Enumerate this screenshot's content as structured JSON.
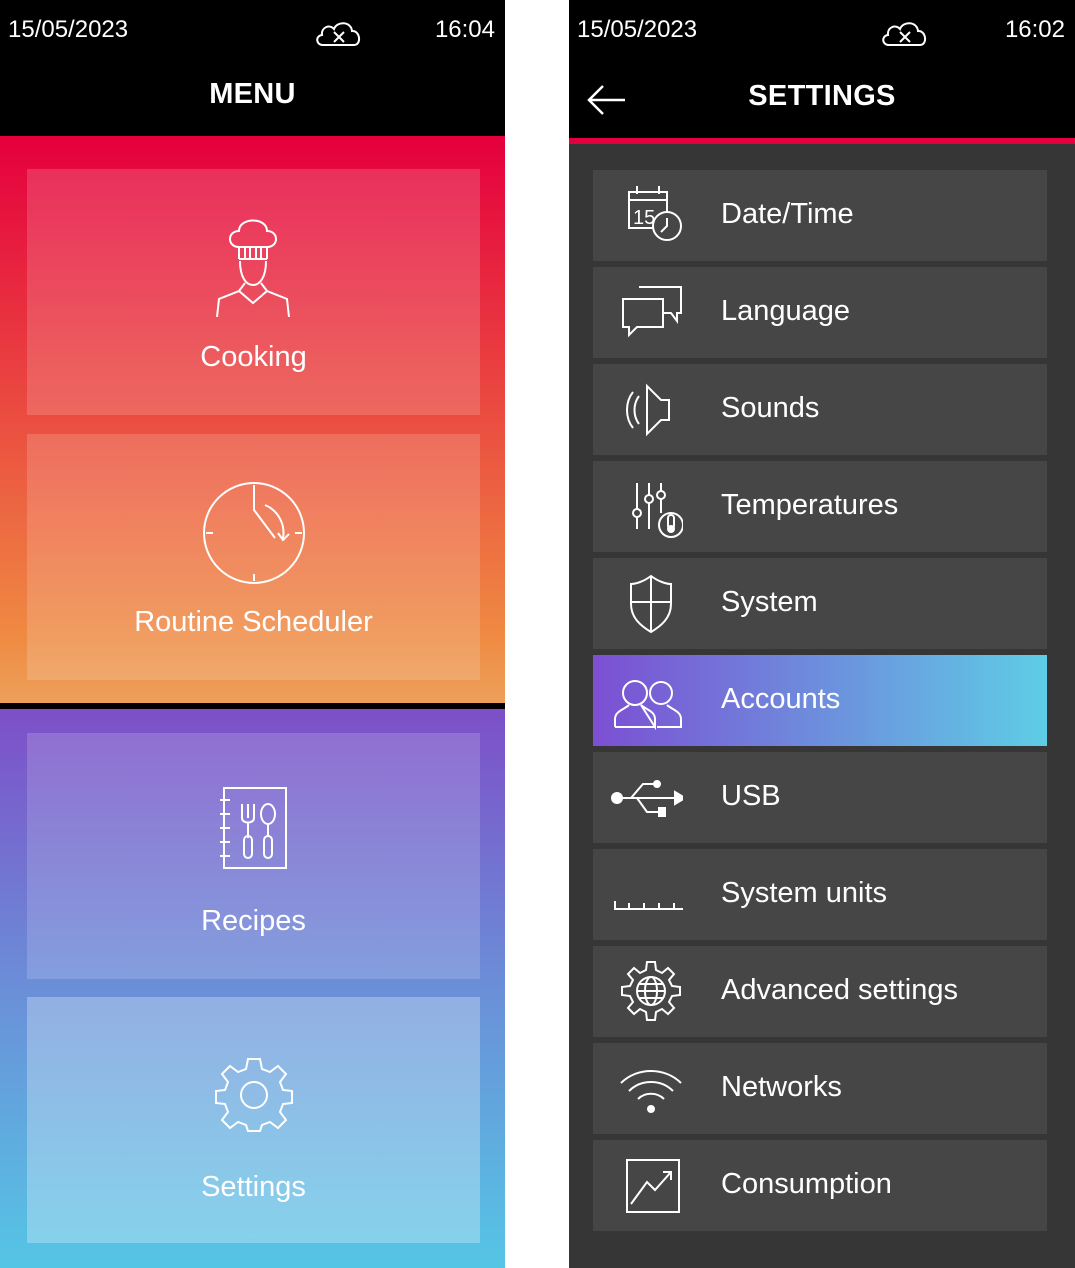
{
  "menu": {
    "status": {
      "date": "15/05/2023",
      "time": "16:04",
      "cloud_icon": "cloud-disconnected-icon"
    },
    "title": "MENU",
    "tiles": [
      {
        "label": "Cooking",
        "icon": "chef-icon"
      },
      {
        "label": "Routine Scheduler",
        "icon": "clock-icon"
      },
      {
        "label": "Recipes",
        "icon": "recipe-book-icon"
      },
      {
        "label": "Settings",
        "icon": "gear-icon"
      }
    ],
    "colors": {
      "accent_red": "#e5003d",
      "warm_top": "#e5003e",
      "warm_bottom": "#eda05a",
      "cool_top": "#7d4fc8",
      "cool_bottom": "#55c5e5"
    }
  },
  "settings": {
    "status": {
      "date": "15/05/2023",
      "time": "16:02",
      "cloud_icon": "cloud-disconnected-icon"
    },
    "title": "SETTINGS",
    "back_icon": "back-arrow-icon",
    "items": [
      {
        "label": "Date/Time",
        "icon": "calendar-clock-icon"
      },
      {
        "label": "Language",
        "icon": "chat-bubbles-icon"
      },
      {
        "label": "Sounds",
        "icon": "speaker-icon"
      },
      {
        "label": "Temperatures",
        "icon": "sliders-thermometer-icon"
      },
      {
        "label": "System",
        "icon": "shield-icon"
      },
      {
        "label": "Accounts",
        "icon": "users-icon",
        "selected": true
      },
      {
        "label": "USB",
        "icon": "usb-icon"
      },
      {
        "label": "System units",
        "icon": "ruler-icon"
      },
      {
        "label": "Advanced settings",
        "icon": "gear-globe-icon"
      },
      {
        "label": "Networks",
        "icon": "wifi-icon"
      },
      {
        "label": "Consumption",
        "icon": "chart-icon"
      }
    ],
    "colors": {
      "row_bg": "#464646",
      "screen_bg": "#363636",
      "selected_start": "#7c4fd3",
      "selected_end": "#5ecde6"
    }
  }
}
